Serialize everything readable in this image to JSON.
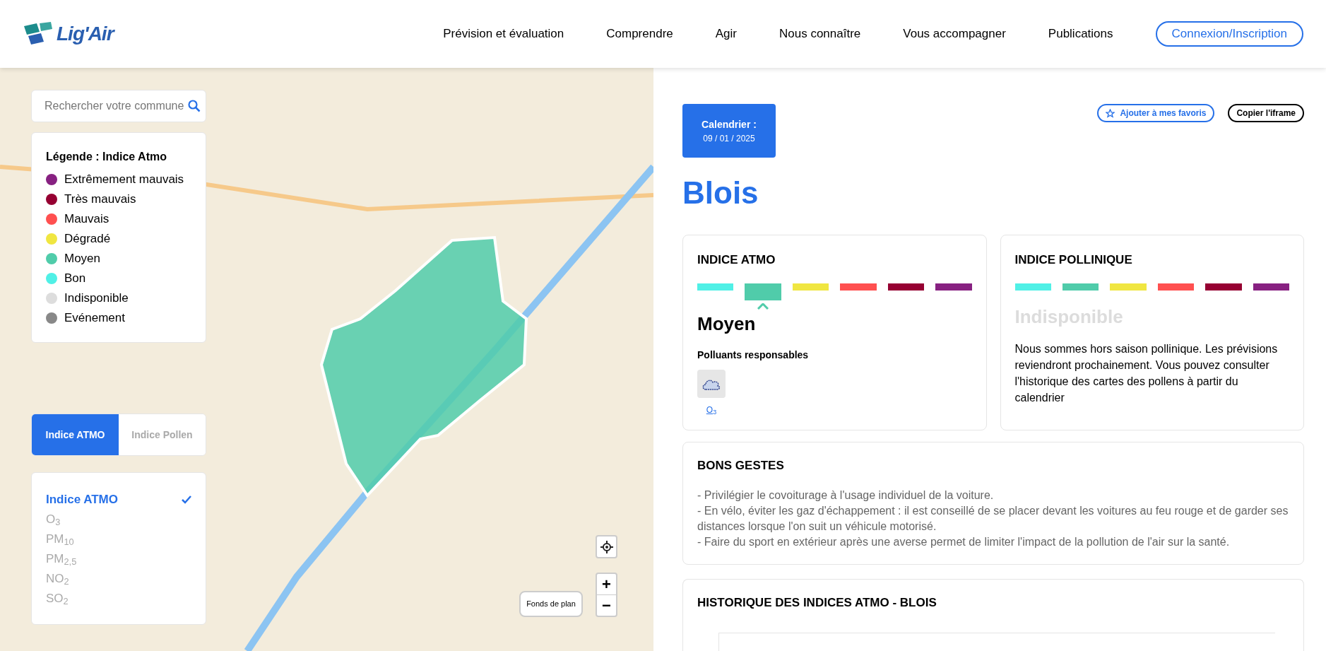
{
  "header": {
    "logo": "Lig'Air",
    "nav": [
      "Prévision et évaluation",
      "Comprendre",
      "Agir",
      "Nous connaître",
      "Vous accompagner",
      "Publications"
    ],
    "login": "Connexion/Inscription"
  },
  "map": {
    "search": {
      "placeholder": "Rechercher votre commune"
    },
    "legend": {
      "title": "Légende : Indice Atmo",
      "items": [
        {
          "label": "Extrêmement mauvais",
          "color": "#872181"
        },
        {
          "label": "Très mauvais",
          "color": "#960032"
        },
        {
          "label": "Mauvais",
          "color": "#ff5050"
        },
        {
          "label": "Dégradé",
          "color": "#f0e641"
        },
        {
          "label": "Moyen",
          "color": "#50ccaa"
        },
        {
          "label": "Bon",
          "color": "#50f0e6"
        },
        {
          "label": "Indisponible",
          "color": "#dddddd"
        },
        {
          "label": "Evénement",
          "color": "#888888"
        }
      ]
    },
    "index_tabs": [
      {
        "label": "Indice ATMO",
        "selected": true
      },
      {
        "label": "Indice Pollen",
        "selected": false
      }
    ],
    "layers": [
      {
        "label": "Indice ATMO",
        "selected": true
      },
      {
        "label": "O$_{3}$",
        "selected": false
      },
      {
        "label": "PM$_{10}$",
        "selected": false
      },
      {
        "label": "PM$_{2,5}$",
        "selected": false
      },
      {
        "label": "NO$_{2}$",
        "selected": false
      },
      {
        "label": "SO$_{2}$",
        "selected": false
      }
    ],
    "zoom_in": "+",
    "zoom_out": "−",
    "basemap_button": "Fonds de plan"
  },
  "calendar": {
    "label": "Calendrier :",
    "date": "09 / 01 / 2025"
  },
  "favorite_button": "Ajouter à mes favoris",
  "iframe_button": "Copier l'iframe",
  "city": "Blois",
  "atmo_card": {
    "title": "INDICE ATMO",
    "scale": [
      {
        "color": "#50f0e6",
        "selected": false
      },
      {
        "color": "#50ccaa",
        "selected": true
      },
      {
        "color": "#f0e641",
        "selected": false
      },
      {
        "color": "#ff5050",
        "selected": false
      },
      {
        "color": "#960032",
        "selected": false
      },
      {
        "color": "#872181",
        "selected": false
      }
    ],
    "level": "Moyen",
    "pollutants_title": "Polluants responsables",
    "pollutants": [
      "O$_{3}$"
    ]
  },
  "pollen_card": {
    "title": "INDICE POLLINIQUE",
    "scale": [
      {
        "color": "#50f0e6",
        "selected": false
      },
      {
        "color": "#50ccaa",
        "selected": false
      },
      {
        "color": "#f0e641",
        "selected": false
      },
      {
        "color": "#ff5050",
        "selected": false
      },
      {
        "color": "#960032",
        "selected": false
      },
      {
        "color": "#872181",
        "selected": false
      }
    ],
    "level": "Indisponible",
    "text": "Nous sommes hors saison pollinique. Les prévisions reviendront prochainement. Vous pouvez consulter l'historique des cartes des pollens à partir du calendrier"
  },
  "tips_card": {
    "title": "BONS GESTES",
    "lines": [
      "- Privilégier le covoiturage à l'usage individuel de la voiture.",
      "- En vélo, éviter les gaz d'échappement : il est conseillé de se placer devant les voitures au feu rouge et de garder ses distances lorsque l'on suit un véhicule motorisé.",
      "- Faire du sport en extérieur après une averse permet de limiter l'impact de la pollution de l'air sur la santé."
    ]
  },
  "history_card": {
    "title": "HISTORIQUE DES INDICES ATMO - BLOIS"
  }
}
